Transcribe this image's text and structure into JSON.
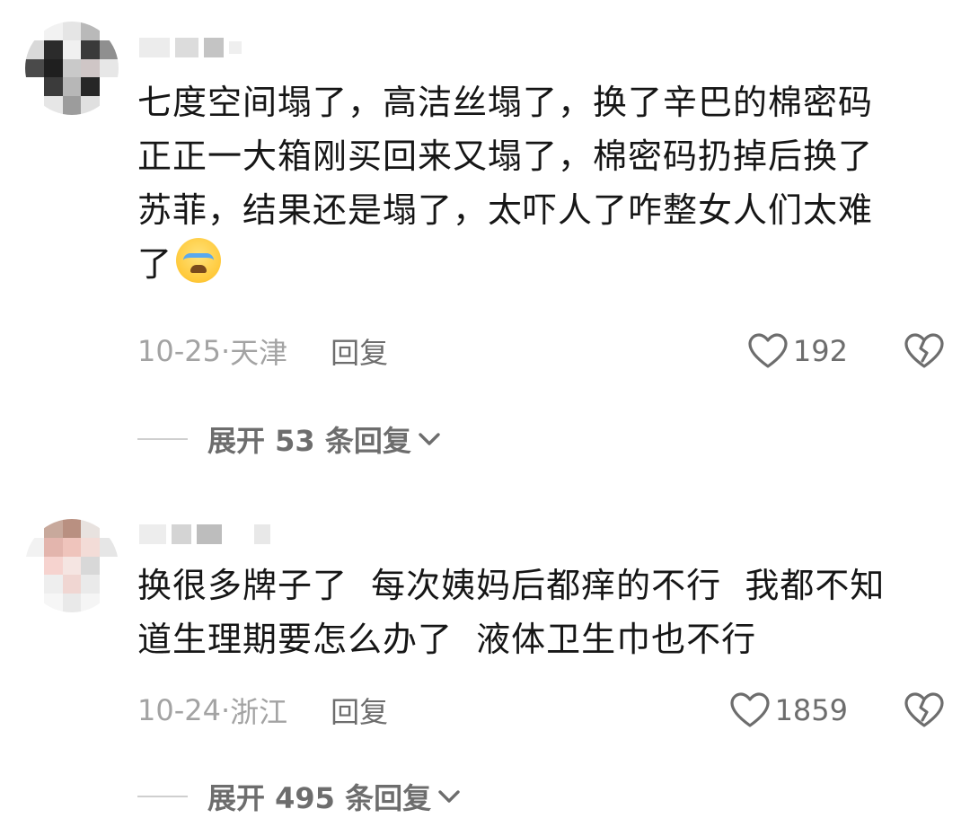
{
  "comments": [
    {
      "lines": [
        "七度空间塌了，高洁丝塌了，换了辛巴的棉密码",
        "正正一大箱刚买回来又塌了，棉密码扔掉后换了",
        "苏菲，结果还是塌了，太吓人了咋整女人们太难",
        "了"
      ],
      "emoji": "loudly-crying-face",
      "date": "10-25",
      "location": "天津",
      "reply_label": "回复",
      "likes": "192",
      "expand_label": "展开 53 条回复"
    },
    {
      "lines": [
        "换很多牌子了  每次姨妈后都痒的不行  我都不知",
        "道生理期要怎么办了  液体卫生巾也不行"
      ],
      "date": "10-24",
      "location": "浙江",
      "reply_label": "回复",
      "likes": "1859",
      "expand_label": "展开 495 条回复"
    }
  ],
  "separator": "·",
  "colors": {
    "text": "#161616",
    "meta": "#a3a3a3",
    "action": "#6d6d6d"
  }
}
